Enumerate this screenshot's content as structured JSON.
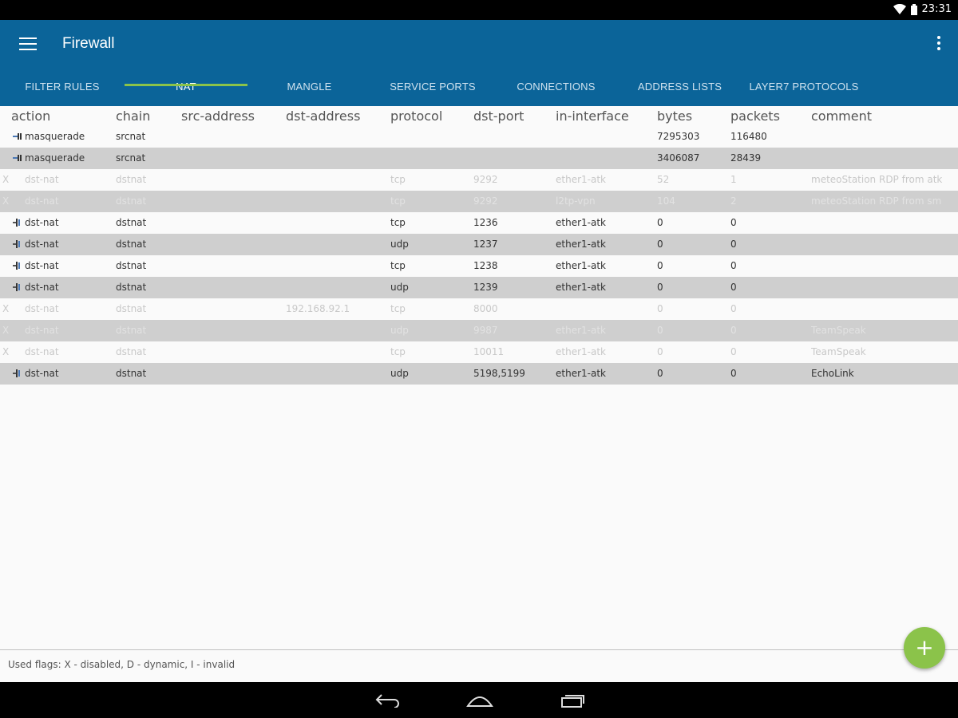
{
  "status": {
    "time": "23:31"
  },
  "app": {
    "title": "Firewall"
  },
  "tabs": [
    {
      "label": "FILTER RULES"
    },
    {
      "label": "NAT"
    },
    {
      "label": "MANGLE"
    },
    {
      "label": "SERVICE PORTS"
    },
    {
      "label": "CONNECTIONS"
    },
    {
      "label": "ADDRESS LISTS"
    },
    {
      "label": "LAYER7 PROTOCOLS"
    }
  ],
  "columns": [
    "action",
    "chain",
    "src-address",
    "dst-address",
    "protocol",
    "dst-port",
    "in-interface",
    "bytes",
    "packets",
    "comment"
  ],
  "rows": [
    {
      "flag": "",
      "icon": "masquerade-icon",
      "action": "masquerade",
      "chain": "srcnat",
      "src": "",
      "dst": "",
      "protocol": "",
      "port": "",
      "iface": "",
      "bytes": "7295303",
      "packets": "116480",
      "comment": ""
    },
    {
      "flag": "",
      "icon": "masquerade-icon",
      "action": "masquerade",
      "chain": "srcnat",
      "src": "",
      "dst": "",
      "protocol": "",
      "port": "",
      "iface": "",
      "bytes": "3406087",
      "packets": "28439",
      "comment": ""
    },
    {
      "flag": "X",
      "icon": "",
      "action": "dst-nat",
      "chain": "dstnat",
      "src": "",
      "dst": "",
      "protocol": "tcp",
      "port": "9292",
      "iface": "ether1-atk",
      "bytes": "52",
      "packets": "1",
      "comment": "meteoStation RDP from atk"
    },
    {
      "flag": "X",
      "icon": "",
      "action": "dst-nat",
      "chain": "dstnat",
      "src": "",
      "dst": "",
      "protocol": "tcp",
      "port": "9292",
      "iface": "l2tp-vpn",
      "bytes": "104",
      "packets": "2",
      "comment": "meteoStation RDP from sm"
    },
    {
      "flag": "",
      "icon": "dstnat-icon",
      "action": "dst-nat",
      "chain": "dstnat",
      "src": "",
      "dst": "",
      "protocol": "tcp",
      "port": "1236",
      "iface": "ether1-atk",
      "bytes": "0",
      "packets": "0",
      "comment": ""
    },
    {
      "flag": "",
      "icon": "dstnat-icon",
      "action": "dst-nat",
      "chain": "dstnat",
      "src": "",
      "dst": "",
      "protocol": "udp",
      "port": "1237",
      "iface": "ether1-atk",
      "bytes": "0",
      "packets": "0",
      "comment": ""
    },
    {
      "flag": "",
      "icon": "dstnat-icon",
      "action": "dst-nat",
      "chain": "dstnat",
      "src": "",
      "dst": "",
      "protocol": "tcp",
      "port": "1238",
      "iface": "ether1-atk",
      "bytes": "0",
      "packets": "0",
      "comment": ""
    },
    {
      "flag": "",
      "icon": "dstnat-icon",
      "action": "dst-nat",
      "chain": "dstnat",
      "src": "",
      "dst": "",
      "protocol": "udp",
      "port": "1239",
      "iface": "ether1-atk",
      "bytes": "0",
      "packets": "0",
      "comment": ""
    },
    {
      "flag": "X",
      "icon": "",
      "action": "dst-nat",
      "chain": "dstnat",
      "src": "",
      "dst": "192.168.92.1",
      "protocol": "tcp",
      "port": "8000",
      "iface": "",
      "bytes": "0",
      "packets": "0",
      "comment": ""
    },
    {
      "flag": "X",
      "icon": "",
      "action": "dst-nat",
      "chain": "dstnat",
      "src": "",
      "dst": "",
      "protocol": "udp",
      "port": "9987",
      "iface": "ether1-atk",
      "bytes": "0",
      "packets": "0",
      "comment": "TeamSpeak"
    },
    {
      "flag": "X",
      "icon": "",
      "action": "dst-nat",
      "chain": "dstnat",
      "src": "",
      "dst": "",
      "protocol": "tcp",
      "port": "10011",
      "iface": "ether1-atk",
      "bytes": "0",
      "packets": "0",
      "comment": "TeamSpeak"
    },
    {
      "flag": "",
      "icon": "dstnat-icon",
      "action": "dst-nat",
      "chain": "dstnat",
      "src": "",
      "dst": "",
      "protocol": "udp",
      "port": "5198,5199",
      "iface": "ether1-atk",
      "bytes": "0",
      "packets": "0",
      "comment": "EchoLink"
    }
  ],
  "footer": {
    "flags": "Used flags: X - disabled, D - dynamic, I - invalid"
  },
  "fab": {
    "label": "+"
  },
  "colors": {
    "appbar": "#0b6499",
    "accent": "#8bc34a"
  }
}
